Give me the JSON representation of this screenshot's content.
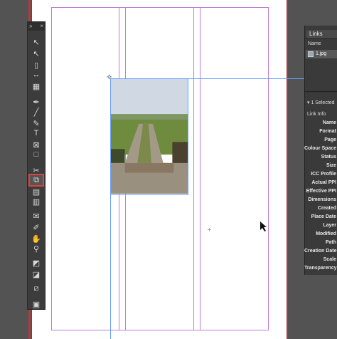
{
  "toolbar": {
    "header_left": "»",
    "header_right": "×",
    "tools": [
      {
        "name": "selection-tool",
        "icon": "selection-arrow-icon",
        "glyph": "↖"
      },
      {
        "name": "direct-selection-tool",
        "icon": "direct-selection-icon",
        "glyph": "↖"
      },
      {
        "name": "page-tool",
        "icon": "page-icon",
        "glyph": "▯"
      },
      {
        "name": "gap-tool",
        "icon": "gap-icon",
        "glyph": "↔"
      },
      {
        "name": "content-collector-tool",
        "icon": "content-collector-icon",
        "glyph": "▦"
      },
      {
        "name": "pen-tool",
        "icon": "pen-icon",
        "glyph": "✒"
      },
      {
        "name": "line-tool",
        "icon": "line-icon",
        "glyph": "╱"
      },
      {
        "name": "pencil-tool",
        "icon": "pencil-icon",
        "glyph": "✎"
      },
      {
        "name": "type-tool",
        "icon": "type-icon",
        "glyph": "T"
      },
      {
        "name": "rectangle-frame-tool",
        "icon": "rectangle-frame-icon",
        "glyph": "⊠"
      },
      {
        "name": "rectangle-tool",
        "icon": "rectangle-icon",
        "glyph": "□"
      },
      {
        "name": "scissors-tool",
        "icon": "scissors-icon",
        "glyph": "✂"
      },
      {
        "name": "free-transform-tool",
        "icon": "free-transform-icon",
        "glyph": "⧉"
      },
      {
        "name": "gradient-swatch-tool",
        "icon": "gradient-icon",
        "glyph": "▤"
      },
      {
        "name": "gradient-feather-tool",
        "icon": "gradient-feather-icon",
        "glyph": "▥"
      },
      {
        "name": "note-tool",
        "icon": "note-icon",
        "glyph": "✉"
      },
      {
        "name": "eyedropper-tool",
        "icon": "eyedropper-icon",
        "glyph": "✐"
      },
      {
        "name": "hand-tool",
        "icon": "hand-icon",
        "glyph": "✋"
      },
      {
        "name": "zoom-tool",
        "icon": "zoom-icon",
        "glyph": "⚲"
      },
      {
        "name": "fill-stroke-swatches",
        "icon": "fill-stroke-icon",
        "glyph": "◩"
      },
      {
        "name": "default-colors",
        "icon": "default-colors-icon",
        "glyph": "◪"
      },
      {
        "name": "apply-none",
        "icon": "apply-none-icon",
        "glyph": "⧄"
      },
      {
        "name": "screen-mode",
        "icon": "screen-mode-icon",
        "glyph": "▣"
      }
    ]
  },
  "links_panel": {
    "tab": "Links",
    "name_header": "Name",
    "file_name": "1.jpg",
    "selected_count": "1 Selected",
    "link_info": "Link Info",
    "info_fields": [
      "Name",
      "Format",
      "Page",
      "Colour Space",
      "Status",
      "Size",
      "ICC Profile",
      "Actual PPI",
      "Effective PPI",
      "Dimensions",
      "Created",
      "Place Date",
      "Layer",
      "Modified",
      "Path",
      "Creation Date",
      "Scale",
      "Transparency"
    ]
  }
}
